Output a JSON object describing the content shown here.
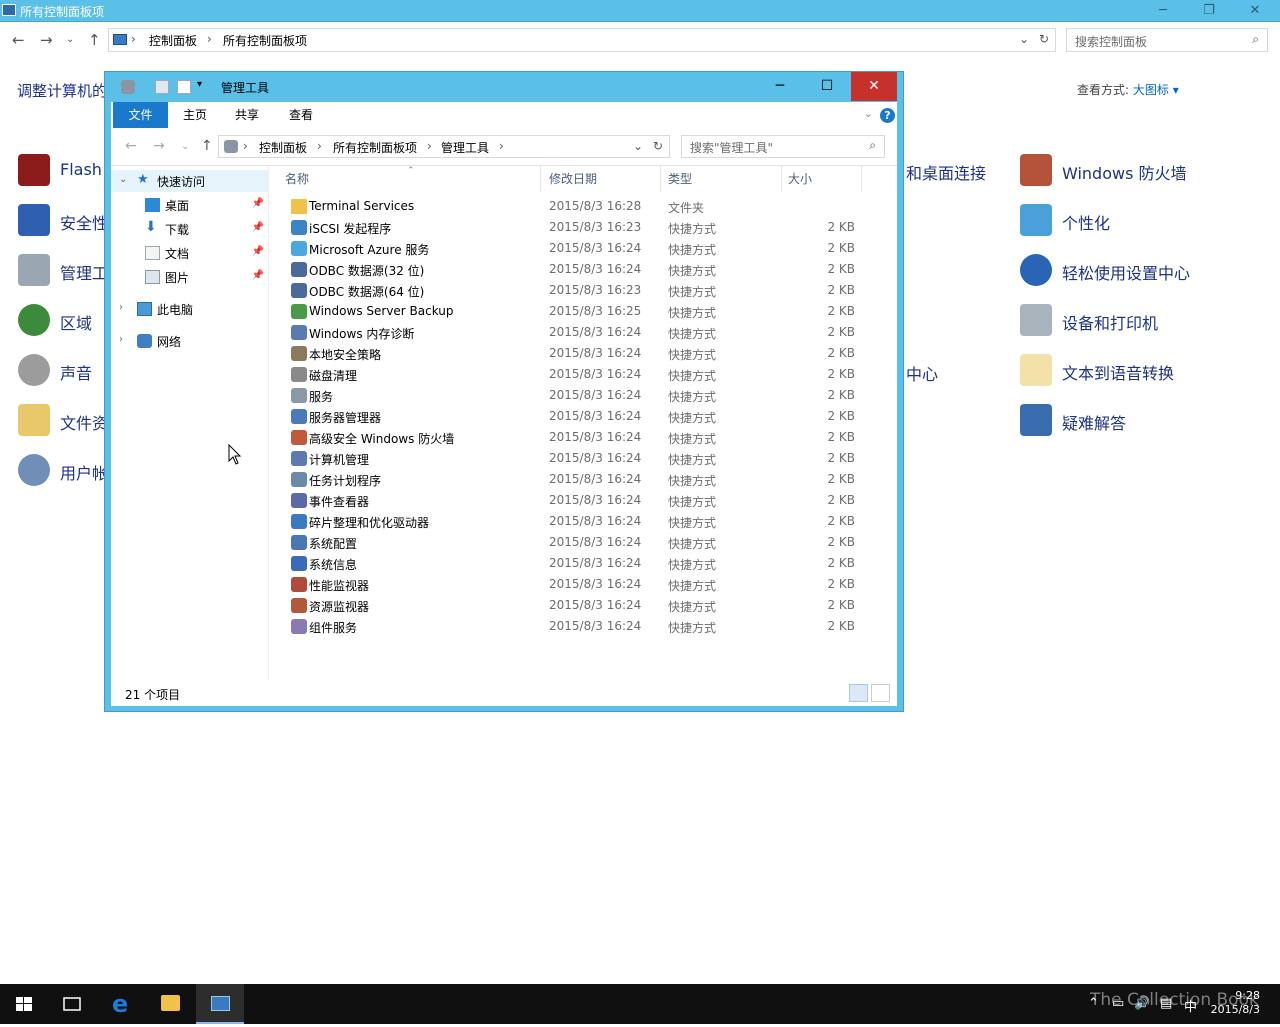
{
  "control_panel": {
    "window_title": "所有控制面板项",
    "address": [
      "控制面板",
      "所有控制面板项"
    ],
    "search_placeholder": "搜索控制面板",
    "heading": "调整计算机的",
    "view_by_label": "查看方式:",
    "view_by_value": "大图标 ▾",
    "left_items": [
      "Flash",
      "安全性",
      "管理工",
      "区域",
      "声音",
      "文件资",
      "用户帐"
    ],
    "mid_items": [
      "和桌面连接",
      "中心"
    ],
    "right_items": [
      "Windows 防火墙",
      "个性化",
      "轻松使用设置中心",
      "设备和打印机",
      "文本到语音转换",
      "疑难解答"
    ]
  },
  "explorer": {
    "title": "管理工具",
    "ribbon_tabs": [
      "文件",
      "主页",
      "共享",
      "查看"
    ],
    "address": [
      "控制面板",
      "所有控制面板项",
      "管理工具"
    ],
    "search_placeholder": "搜索\"管理工具\"",
    "tree": {
      "quick_access": "快速访问",
      "desktop": "桌面",
      "downloads": "下载",
      "documents": "文档",
      "pictures": "图片",
      "this_pc": "此电脑",
      "network": "网络"
    },
    "columns": {
      "name": "名称",
      "date": "修改日期",
      "type": "类型",
      "size": "大小"
    },
    "files": [
      {
        "name": "Terminal Services",
        "date": "2015/8/3 16:28",
        "type": "文件夹",
        "size": ""
      },
      {
        "name": "iSCSI 发起程序",
        "date": "2015/8/3 16:23",
        "type": "快捷方式",
        "size": "2 KB"
      },
      {
        "name": "Microsoft Azure 服务",
        "date": "2015/8/3 16:24",
        "type": "快捷方式",
        "size": "2 KB"
      },
      {
        "name": "ODBC 数据源(32 位)",
        "date": "2015/8/3 16:24",
        "type": "快捷方式",
        "size": "2 KB"
      },
      {
        "name": "ODBC 数据源(64 位)",
        "date": "2015/8/3 16:23",
        "type": "快捷方式",
        "size": "2 KB"
      },
      {
        "name": "Windows Server Backup",
        "date": "2015/8/3 16:25",
        "type": "快捷方式",
        "size": "2 KB"
      },
      {
        "name": "Windows 内存诊断",
        "date": "2015/8/3 16:24",
        "type": "快捷方式",
        "size": "2 KB"
      },
      {
        "name": "本地安全策略",
        "date": "2015/8/3 16:24",
        "type": "快捷方式",
        "size": "2 KB"
      },
      {
        "name": "磁盘清理",
        "date": "2015/8/3 16:24",
        "type": "快捷方式",
        "size": "2 KB"
      },
      {
        "name": "服务",
        "date": "2015/8/3 16:24",
        "type": "快捷方式",
        "size": "2 KB"
      },
      {
        "name": "服务器管理器",
        "date": "2015/8/3 16:24",
        "type": "快捷方式",
        "size": "2 KB"
      },
      {
        "name": "高级安全 Windows 防火墙",
        "date": "2015/8/3 16:24",
        "type": "快捷方式",
        "size": "2 KB"
      },
      {
        "name": "计算机管理",
        "date": "2015/8/3 16:24",
        "type": "快捷方式",
        "size": "2 KB"
      },
      {
        "name": "任务计划程序",
        "date": "2015/8/3 16:24",
        "type": "快捷方式",
        "size": "2 KB"
      },
      {
        "name": "事件查看器",
        "date": "2015/8/3 16:24",
        "type": "快捷方式",
        "size": "2 KB"
      },
      {
        "name": "碎片整理和优化驱动器",
        "date": "2015/8/3 16:24",
        "type": "快捷方式",
        "size": "2 KB"
      },
      {
        "name": "系统配置",
        "date": "2015/8/3 16:24",
        "type": "快捷方式",
        "size": "2 KB"
      },
      {
        "name": "系统信息",
        "date": "2015/8/3 16:24",
        "type": "快捷方式",
        "size": "2 KB"
      },
      {
        "name": "性能监视器",
        "date": "2015/8/3 16:24",
        "type": "快捷方式",
        "size": "2 KB"
      },
      {
        "name": "资源监视器",
        "date": "2015/8/3 16:24",
        "type": "快捷方式",
        "size": "2 KB"
      },
      {
        "name": "组件服务",
        "date": "2015/8/3 16:24",
        "type": "快捷方式",
        "size": "2 KB"
      }
    ],
    "status": "21 个项目"
  },
  "taskbar": {
    "time": "9:28",
    "date": "2015/8/3",
    "ime": "中",
    "watermark": "The Collection Book"
  },
  "colors": {
    "titlebar": "#5bc0e8",
    "accent": "#1979ca",
    "close": "#c7312b",
    "link": "#1e3287",
    "taskbar": "#101010"
  }
}
